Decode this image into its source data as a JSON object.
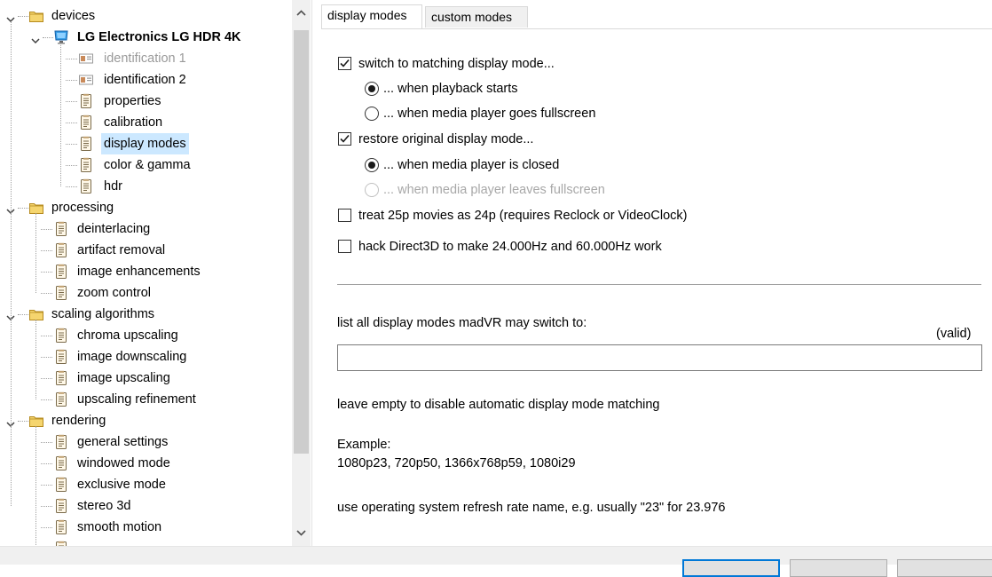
{
  "tree": {
    "nodes": [
      {
        "label": "devices",
        "level": 0,
        "expander": "expanded",
        "icon": "folder-icon",
        "style": ""
      },
      {
        "label": "LG Electronics LG HDR 4K",
        "level": 1,
        "expander": "expanded",
        "icon": "monitor-icon",
        "style": "bold"
      },
      {
        "label": "identification 1",
        "level": 2,
        "expander": "",
        "icon": "id-card-icon",
        "style": "gray"
      },
      {
        "label": "identification 2",
        "level": 2,
        "expander": "",
        "icon": "id-card-icon",
        "style": ""
      },
      {
        "label": "properties",
        "level": 2,
        "expander": "",
        "icon": "page-icon",
        "style": ""
      },
      {
        "label": "calibration",
        "level": 2,
        "expander": "",
        "icon": "page-icon",
        "style": ""
      },
      {
        "label": "display modes",
        "level": 2,
        "expander": "",
        "icon": "page-icon",
        "style": "selected"
      },
      {
        "label": "color & gamma",
        "level": 2,
        "expander": "",
        "icon": "page-icon",
        "style": ""
      },
      {
        "label": "hdr",
        "level": 2,
        "expander": "",
        "icon": "page-icon",
        "style": ""
      },
      {
        "label": "processing",
        "level": 0,
        "expander": "expanded",
        "icon": "folder-icon",
        "style": ""
      },
      {
        "label": "deinterlacing",
        "level": 1,
        "expander": "",
        "icon": "page-icon",
        "style": ""
      },
      {
        "label": "artifact removal",
        "level": 1,
        "expander": "",
        "icon": "page-icon",
        "style": ""
      },
      {
        "label": "image enhancements",
        "level": 1,
        "expander": "",
        "icon": "page-icon",
        "style": ""
      },
      {
        "label": "zoom control",
        "level": 1,
        "expander": "",
        "icon": "page-icon",
        "style": ""
      },
      {
        "label": "scaling algorithms",
        "level": 0,
        "expander": "expanded",
        "icon": "folder-icon",
        "style": ""
      },
      {
        "label": "chroma upscaling",
        "level": 1,
        "expander": "",
        "icon": "page-icon",
        "style": ""
      },
      {
        "label": "image downscaling",
        "level": 1,
        "expander": "",
        "icon": "page-icon",
        "style": ""
      },
      {
        "label": "image upscaling",
        "level": 1,
        "expander": "",
        "icon": "page-icon",
        "style": ""
      },
      {
        "label": "upscaling refinement",
        "level": 1,
        "expander": "",
        "icon": "page-icon",
        "style": ""
      },
      {
        "label": "rendering",
        "level": 0,
        "expander": "expanded",
        "icon": "folder-icon",
        "style": ""
      },
      {
        "label": "general settings",
        "level": 1,
        "expander": "",
        "icon": "page-icon",
        "style": ""
      },
      {
        "label": "windowed mode",
        "level": 1,
        "expander": "",
        "icon": "page-icon",
        "style": ""
      },
      {
        "label": "exclusive mode",
        "level": 1,
        "expander": "",
        "icon": "page-icon",
        "style": ""
      },
      {
        "label": "stereo 3d",
        "level": 1,
        "expander": "",
        "icon": "page-icon",
        "style": ""
      },
      {
        "label": "smooth motion",
        "level": 1,
        "expander": "",
        "icon": "page-icon",
        "style": ""
      },
      {
        "label": "",
        "level": 1,
        "expander": "",
        "icon": "page-icon",
        "style": ""
      }
    ],
    "scrollbar": {
      "up_icon": "chevron-up-icon",
      "down_icon": "chevron-down-icon"
    }
  },
  "tabs": [
    {
      "label": "display modes",
      "active": true
    },
    {
      "label": "custom modes",
      "active": false
    }
  ],
  "options": {
    "switch_matching": {
      "label": "switch to matching display mode...",
      "checked": true
    },
    "when_playback_starts": {
      "label": "... when playback starts",
      "selected": true,
      "enabled": true
    },
    "when_fullscreen": {
      "label": "... when media player goes fullscreen",
      "selected": false,
      "enabled": true
    },
    "restore_original": {
      "label": "restore original display mode...",
      "checked": true
    },
    "when_closed": {
      "label": "... when media player is closed",
      "selected": true,
      "enabled": true
    },
    "when_leaves_fullscreen": {
      "label": "... when media player leaves fullscreen",
      "selected": false,
      "enabled": false
    },
    "treat_25p": {
      "label": "treat 25p movies as 24p  (requires Reclock or VideoClock)",
      "checked": false
    },
    "hack_direct3d": {
      "label": "hack Direct3D to make 24.000Hz and 60.000Hz work",
      "checked": false
    }
  },
  "modes": {
    "label": "list all display modes madVR may switch to:",
    "status": "(valid)",
    "value": "",
    "hint": "leave empty to disable automatic display mode matching",
    "example_title": "Example:",
    "example_value": "1080p23, 720p50, 1366x768p59, 1080i29",
    "note": "use operating system refresh rate name, e.g. usually \"23\" for 23.976"
  },
  "colors": {
    "selection": "#cce8ff",
    "accent": "#0078d7",
    "folder": "#f5d56e"
  }
}
